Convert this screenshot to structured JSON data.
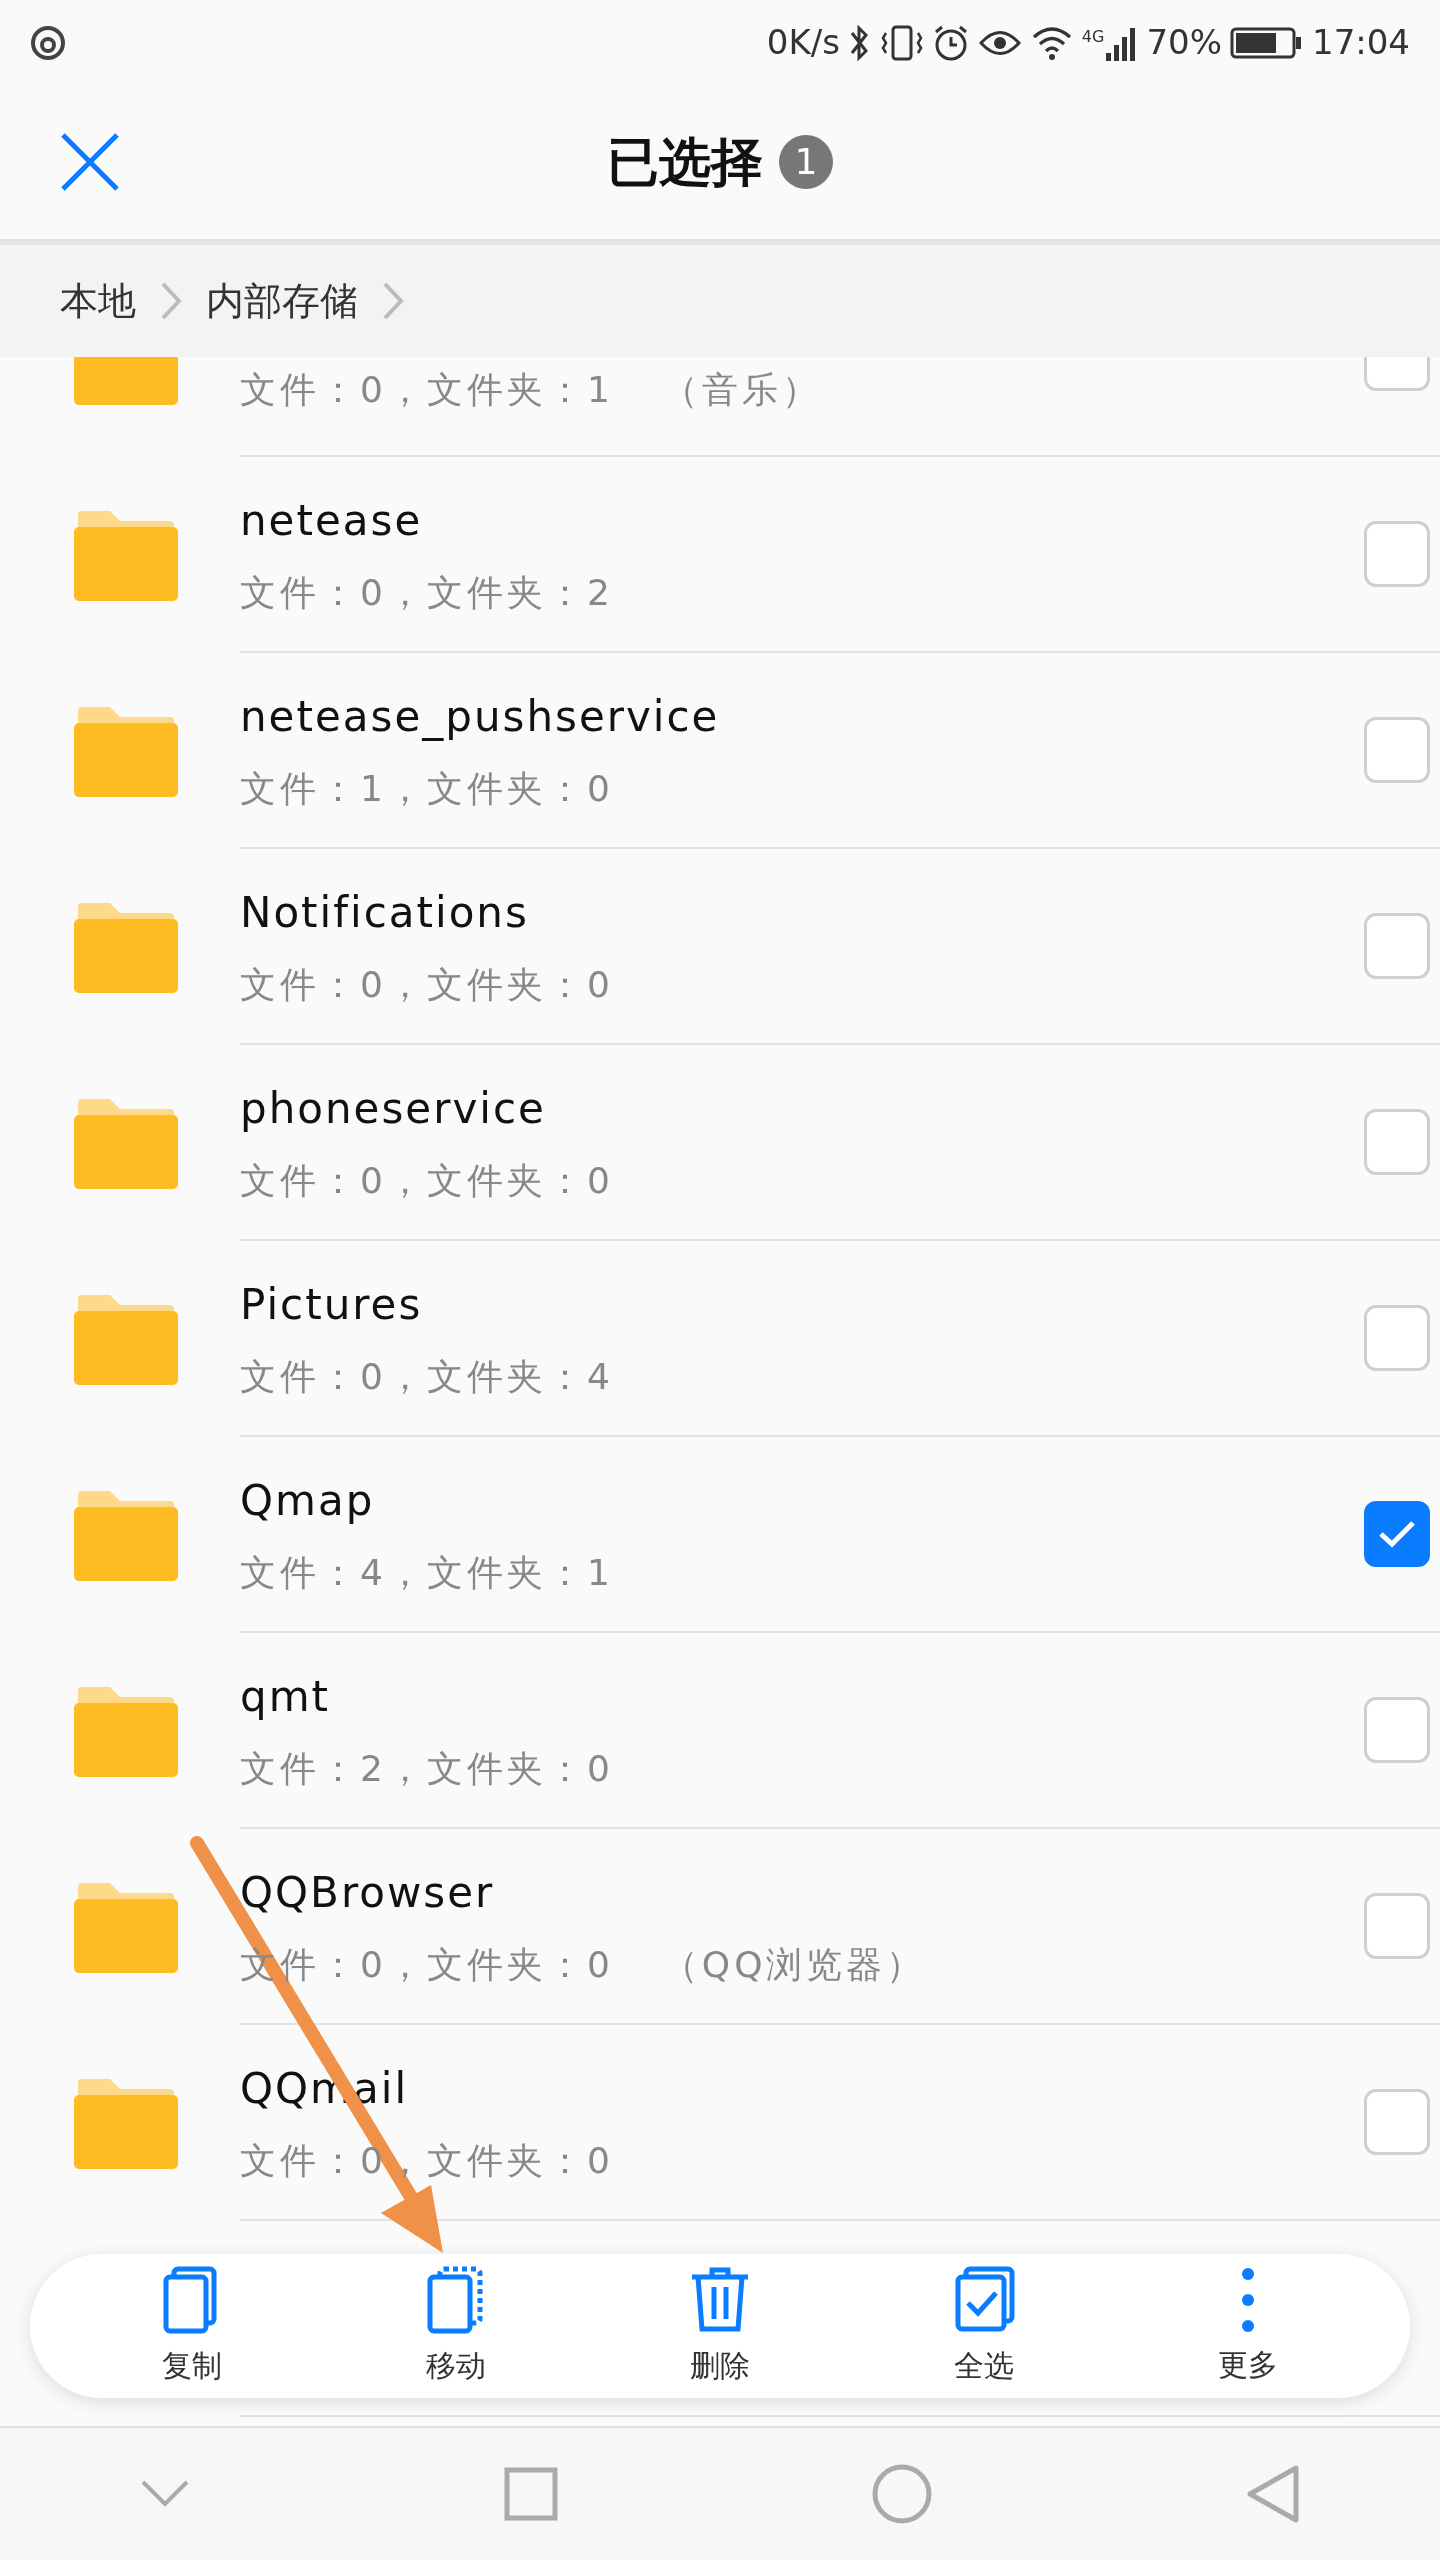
{
  "status_bar": {
    "net_speed": "0K/s",
    "network": "4G",
    "battery": "70%",
    "time": "17:04"
  },
  "header": {
    "title": "已选择",
    "count": "1"
  },
  "breadcrumb": [
    "本地",
    "内部存储"
  ],
  "items": [
    {
      "files": "文件：0，文件夹：1",
      "note": "（音乐）",
      "checked": false
    },
    {
      "name": "netease",
      "files": "文件：0，文件夹：2",
      "checked": false
    },
    {
      "name": "netease_pushservice",
      "files": "文件：1，文件夹：0",
      "checked": false
    },
    {
      "name": "Notifications",
      "files": "文件：0，文件夹：0",
      "checked": false
    },
    {
      "name": "phoneservice",
      "files": "文件：0，文件夹：0",
      "checked": false
    },
    {
      "name": "Pictures",
      "files": "文件：0，文件夹：4",
      "checked": false
    },
    {
      "name": "Qmap",
      "files": "文件：4，文件夹：1",
      "checked": true
    },
    {
      "name": "qmt",
      "files": "文件：2，文件夹：0",
      "checked": false
    },
    {
      "name": "QQBrowser",
      "files": "文件：0，文件夹：0",
      "note": "（QQ浏览器）",
      "checked": false
    },
    {
      "name": "QQmail",
      "files": "文件：0，文件夹：0",
      "checked": false
    }
  ],
  "toolbar": [
    {
      "label": "复制",
      "kind": "copy"
    },
    {
      "label": "移动",
      "kind": "move"
    },
    {
      "label": "删除",
      "kind": "delete"
    },
    {
      "label": "全选",
      "kind": "select-all"
    },
    {
      "label": "更多",
      "kind": "more"
    }
  ]
}
